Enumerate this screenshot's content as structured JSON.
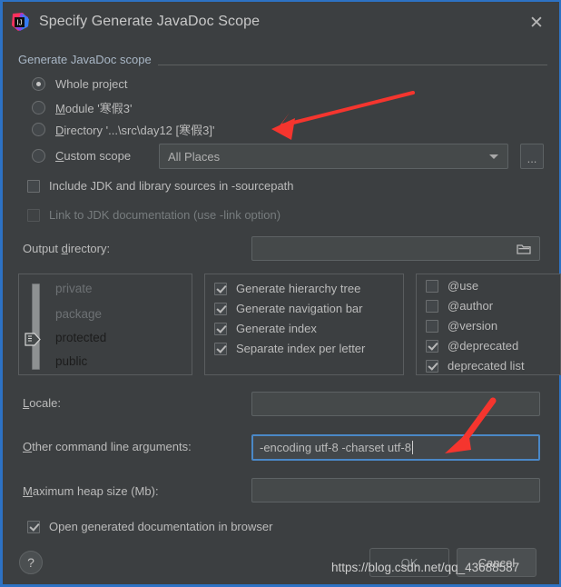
{
  "window": {
    "title": "Specify Generate JavaDoc Scope",
    "close_icon": "close-icon",
    "logo_icon": "intellij-idea-logo-icon",
    "accent_color": "#2d72c4",
    "background_color": "#3c3f41"
  },
  "scope_group": {
    "label": "Generate JavaDoc scope",
    "options": [
      {
        "label": "Whole project",
        "mnemonic": "",
        "checked": true
      },
      {
        "label": "Module '寒假3'",
        "mnemonic": "M",
        "checked": false
      },
      {
        "label": "Directory '...\\src\\day12 [寒假3]'",
        "mnemonic": "D",
        "checked": false
      },
      {
        "label": "Custom scope",
        "mnemonic": "C",
        "checked": false
      }
    ],
    "custom_scope_combo": {
      "value": "All Places",
      "dropdown_icon": "chevron-down-icon"
    },
    "browse_button_label": "..."
  },
  "options": {
    "include_jdk": {
      "label": "Include JDK and library sources in -sourcepath",
      "checked": false,
      "disabled": false
    },
    "link_jdk": {
      "label": "Link to JDK documentation (use -link option)",
      "checked": false,
      "disabled": true
    }
  },
  "output_directory": {
    "label": "Output directory:",
    "mnemonic": "d",
    "value": "",
    "browse_icon": "folder-icon"
  },
  "visibility": {
    "levels": [
      {
        "label": "private",
        "active": false
      },
      {
        "label": "package",
        "active": false
      },
      {
        "label": "protected",
        "active": true
      },
      {
        "label": "public",
        "active": true
      }
    ],
    "slider_icon": "slider-handle-icon"
  },
  "generate_panel": [
    {
      "label": "Generate hierarchy tree",
      "checked": true
    },
    {
      "label": "Generate navigation bar",
      "checked": true
    },
    {
      "label": "Generate index",
      "checked": true
    },
    {
      "label": "Separate index per letter",
      "checked": true
    }
  ],
  "tags_panel": [
    {
      "label": "@use",
      "checked": false
    },
    {
      "label": "@author",
      "checked": false
    },
    {
      "label": "@version",
      "checked": false
    },
    {
      "label": "@deprecated",
      "checked": true
    },
    {
      "label": "deprecated list",
      "checked": true
    }
  ],
  "locale": {
    "label": "Locale:",
    "mnemonic": "L",
    "value": ""
  },
  "other_args": {
    "label": "Other command line arguments:",
    "mnemonic": "O",
    "value": "-encoding utf-8 -charset utf-8",
    "focused": true
  },
  "heap": {
    "label": "Maximum heap size (Mb):",
    "mnemonic": "M",
    "value": ""
  },
  "open_browser": {
    "label": "Open generated documentation in browser",
    "checked": true
  },
  "footer": {
    "help_label": "?",
    "ok_label": "OK",
    "cancel_label": "Cancel",
    "watermark": "https://blog.csdn.net/qq_43688587"
  },
  "annotations": {
    "arrow_color": "#f5352e",
    "arrow_1_target": "directory-radio-row",
    "arrow_2_target": "other-args-input"
  }
}
